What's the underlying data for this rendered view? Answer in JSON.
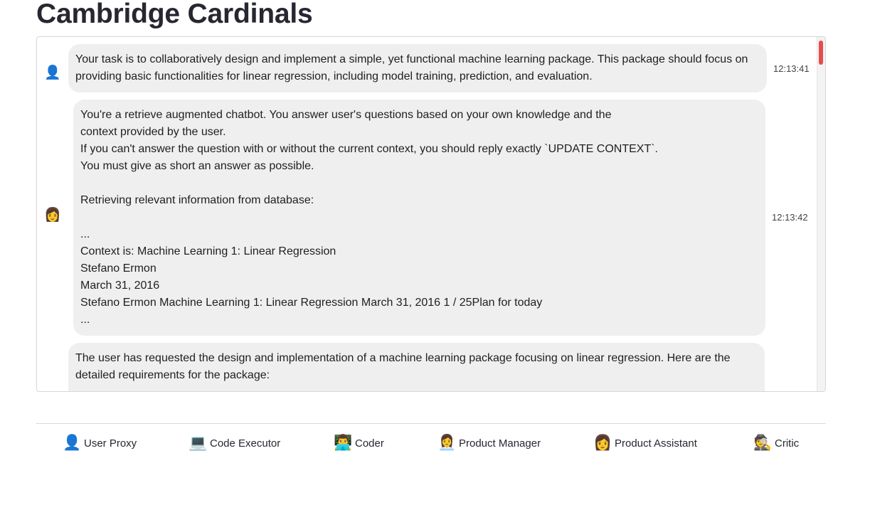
{
  "title": "Cambridge Cardinals",
  "messages": [
    {
      "avatar_icon": "👤",
      "avatar_name": "user-icon",
      "text": "Your task is to collaboratively design and implement a simple, yet functional machine learning package. This package should focus on providing basic functionalities for linear regression, including model training, prediction, and evaluation.",
      "time": "12:13:41"
    },
    {
      "avatar_icon": "👩",
      "avatar_name": "woman-icon",
      "text": "You're a retrieve augmented chatbot. You answer user's questions based on your own knowledge and the\ncontext provided by the user.\nIf you can't answer the question with or without the current context, you should reply exactly `UPDATE CONTEXT`.\nYou must give as short an answer as possible.\n\nRetrieving relevant information from database:\n\n...\nContext is: Machine Learning 1: Linear Regression\nStefano Ermon\nMarch 31, 2016\nStefano Ermon Machine Learning 1: Linear Regression March 31, 2016 1 / 25Plan for today\n...",
      "time": "12:13:42"
    },
    {
      "avatar_icon": "",
      "avatar_name": "avatar",
      "text": "The user has requested the design and implementation of a machine learning package focusing on linear regression. Here are the detailed requirements for the package:",
      "time": ""
    }
  ],
  "agents": [
    {
      "icon": "👤",
      "icon_name": "user-proxy-icon",
      "label": "User Proxy"
    },
    {
      "icon": "💻",
      "icon_name": "laptop-icon",
      "label": "Code Executor"
    },
    {
      "icon": "👨‍💻",
      "icon_name": "technologist-icon",
      "label": "Coder"
    },
    {
      "icon": "👩‍💼",
      "icon_name": "office-worker-icon",
      "label": "Product Manager"
    },
    {
      "icon": "👩",
      "icon_name": "woman-icon",
      "label": "Product Assistant"
    },
    {
      "icon": "🕵️",
      "icon_name": "detective-icon",
      "label": "Critic"
    }
  ],
  "colors": {
    "bubble": "#efefef",
    "scroll_thumb": "#e74c4c"
  }
}
